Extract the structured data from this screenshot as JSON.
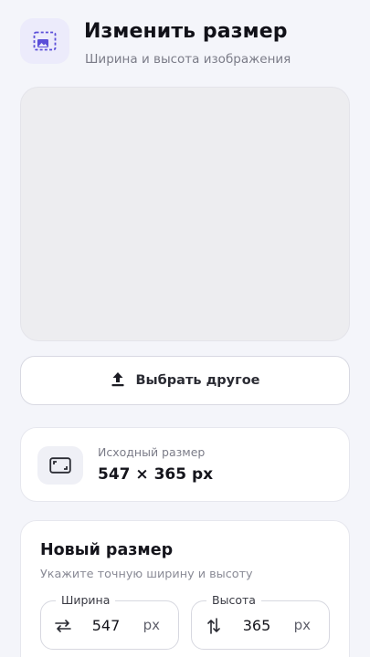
{
  "header": {
    "title": "Изменить размер",
    "subtitle": "Ширина и высота изображения",
    "icon": "resize-image-icon",
    "accent_color": "#5b4fd8"
  },
  "preview": {
    "state": "empty"
  },
  "actions": {
    "choose_other_label": "Выбрать другое",
    "choose_other_icon": "upload-icon"
  },
  "original": {
    "label": "Исходный размер",
    "value": "547 × 365 px",
    "icon": "aspect-ratio-icon"
  },
  "new_size": {
    "title": "Новый размер",
    "subtitle": "Укажите точную ширину и высоту",
    "width": {
      "label": "Ширина",
      "value": "547",
      "unit": "px",
      "icon": "swap-horizontal-icon"
    },
    "height": {
      "label": "Высота",
      "value": "365",
      "unit": "px",
      "icon": "swap-vertical-icon"
    }
  }
}
